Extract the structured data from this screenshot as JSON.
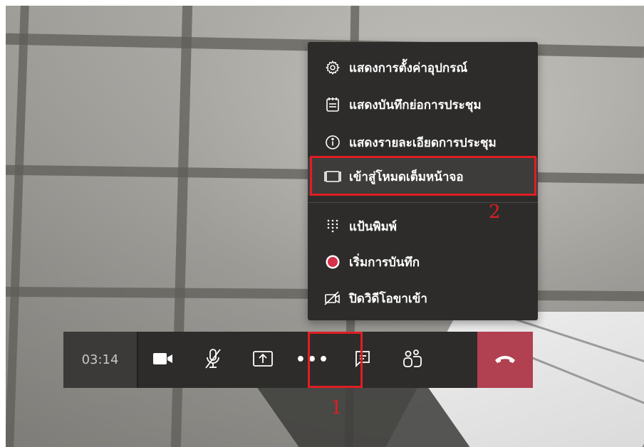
{
  "call": {
    "timer": "03:14",
    "controls": [
      {
        "name": "camera-button",
        "icon": "video-camera-icon"
      },
      {
        "name": "mute-button",
        "icon": "microphone-off-icon"
      },
      {
        "name": "share-button",
        "icon": "share-screen-icon"
      },
      {
        "name": "more-actions-button",
        "icon": "more-horizontal-icon",
        "label": "•••"
      },
      {
        "name": "chat-button",
        "icon": "chat-icon"
      },
      {
        "name": "participants-button",
        "icon": "people-icon"
      },
      {
        "name": "hang-up-button",
        "icon": "phone-hangup-icon"
      }
    ],
    "hangup_color": "#b14050"
  },
  "menu": {
    "items": [
      {
        "label": "แสดงการตั้งค่าอุปกรณ์",
        "icon": "gear-icon"
      },
      {
        "label": "แสดงบันทึกย่อการประชุม",
        "icon": "notes-icon"
      },
      {
        "label": "แสดงรายละเอียดการประชุม",
        "icon": "info-icon"
      },
      {
        "label": "เข้าสู่โหมดเต็มหน้าจอ",
        "icon": "fullscreen-icon"
      },
      {
        "label": "แป้นพิมพ์",
        "icon": "dialpad-icon"
      },
      {
        "label": "เริ่มการบันทึก",
        "icon": "record-icon"
      },
      {
        "label": "ปิดวิดีโอขาเข้า",
        "icon": "video-off-icon"
      }
    ]
  },
  "annotations": {
    "one": "1",
    "two": "2",
    "color": "#e01e23"
  }
}
